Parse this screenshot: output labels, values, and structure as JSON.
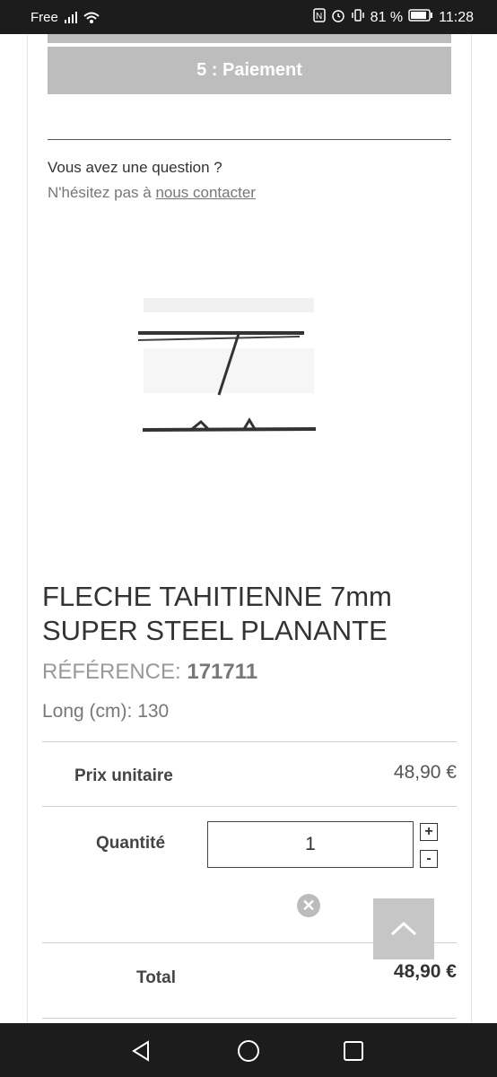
{
  "status_bar": {
    "carrier": "Free",
    "battery": "81 %",
    "time": "11:28"
  },
  "checkout": {
    "step_label": "5 : Paiement"
  },
  "help": {
    "question": "Vous avez une question ?",
    "prefix": "N'hésitez pas à",
    "link": "nous contacter"
  },
  "product": {
    "name": "FLECHE TAHITIENNE 7mm SUPER STEEL PLANANTE",
    "ref_label": "RÉFÉRENCE:",
    "ref_value": "171711",
    "option": "Long (cm): 130",
    "unit_price_label": "Prix unitaire",
    "unit_price": "48,90 €",
    "quantity_label": "Quantité",
    "quantity": "1",
    "plus": "+",
    "minus": "-",
    "total_label": "Total",
    "total": "48,90 €"
  },
  "colors": {
    "step_bg": "#bdbdbd",
    "status_bg": "#1c1c1c",
    "backtop_bg": "#c6c6c6"
  }
}
